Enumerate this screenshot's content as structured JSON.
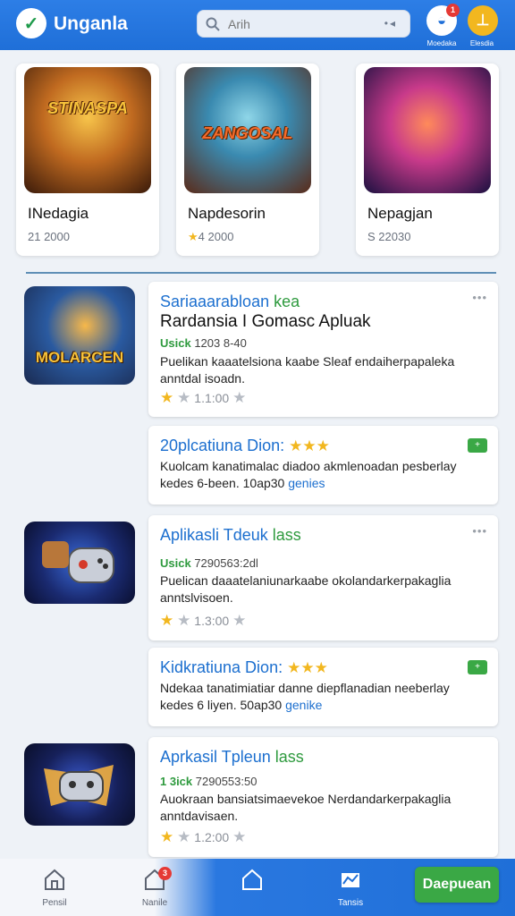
{
  "header": {
    "title": "Unganla",
    "search_placeholder": "Arih",
    "notif_badge": "1",
    "btn1_caption": "Moedaka",
    "btn2_caption": "Elesdia"
  },
  "featured": [
    {
      "art_text": "STINASPA",
      "name": "INedagia",
      "meta": "21 2000",
      "colors": [
        "#f0a83a",
        "#6b3a1a"
      ]
    },
    {
      "art_text": "ZANGOSAL",
      "name": "Napdesorin",
      "meta": "4 2000",
      "colors": [
        "#3aa0c8",
        "#c84a1a"
      ]
    },
    {
      "art_text": "",
      "name": "Nepagjan",
      "meta": "S 22030",
      "colors": [
        "#e83a6a",
        "#2a1a6a"
      ]
    }
  ],
  "list": [
    {
      "thumb_text": "MOLARCEN",
      "title_blue": "Sariaaarabloan",
      "title_green": "kea",
      "subtitle": "Rardansia I Gomasc Apluak",
      "meta_green": "Usick",
      "meta_rest": "1203 8-40",
      "desc": "Puelikan kaaatelsiona kaabe Sleaf endaiherpapaleka anntdal isoadn.",
      "rating": "1.1:00"
    },
    {
      "title": "20plcatiuna Dion:",
      "desc_line1": "Kuolcam kanatimalac diadoo akmlenoadan pesberlay",
      "desc_line2": "kedes 6-been. 10ap30",
      "link": "genies",
      "tag": "+"
    },
    {
      "title_blue": "Aplikasli Tdeuk",
      "title_green": "lass",
      "meta_green": "Usick",
      "meta_rest": "7290563:2dl",
      "desc": "Puelican daaatelaniunarkaabe okolandarkerpakaglia anntslvisoen.",
      "rating": "1.3:00"
    },
    {
      "title": "Kidkratiuna Dion:",
      "desc_line1": "Ndekaa tanatimiatiar danne diepflanadian neeberlay",
      "desc_line2": "kedes 6 liyen. 50ap30",
      "link": "genike",
      "tag": "+"
    },
    {
      "title_blue": "Aprkasil Tpleun",
      "title_green": "lass",
      "meta_green": "1 3ick",
      "meta_rest": "7290553:50",
      "desc": "Auokraan bansiatsimaevekoe Nerdandarkerpakaglia anntdavisaen.",
      "rating": "1.2:00"
    }
  ],
  "bottom_nav": {
    "items": [
      {
        "label": "Pensil"
      },
      {
        "label": "Nanile"
      },
      {
        "label": ""
      },
      {
        "label": "Tansis"
      }
    ],
    "badge": "3",
    "cta": "Daepuean"
  },
  "colors": {
    "header_blue": "#1f6fd8",
    "accent_green": "#3aa845",
    "star_gold": "#f2b71f"
  }
}
